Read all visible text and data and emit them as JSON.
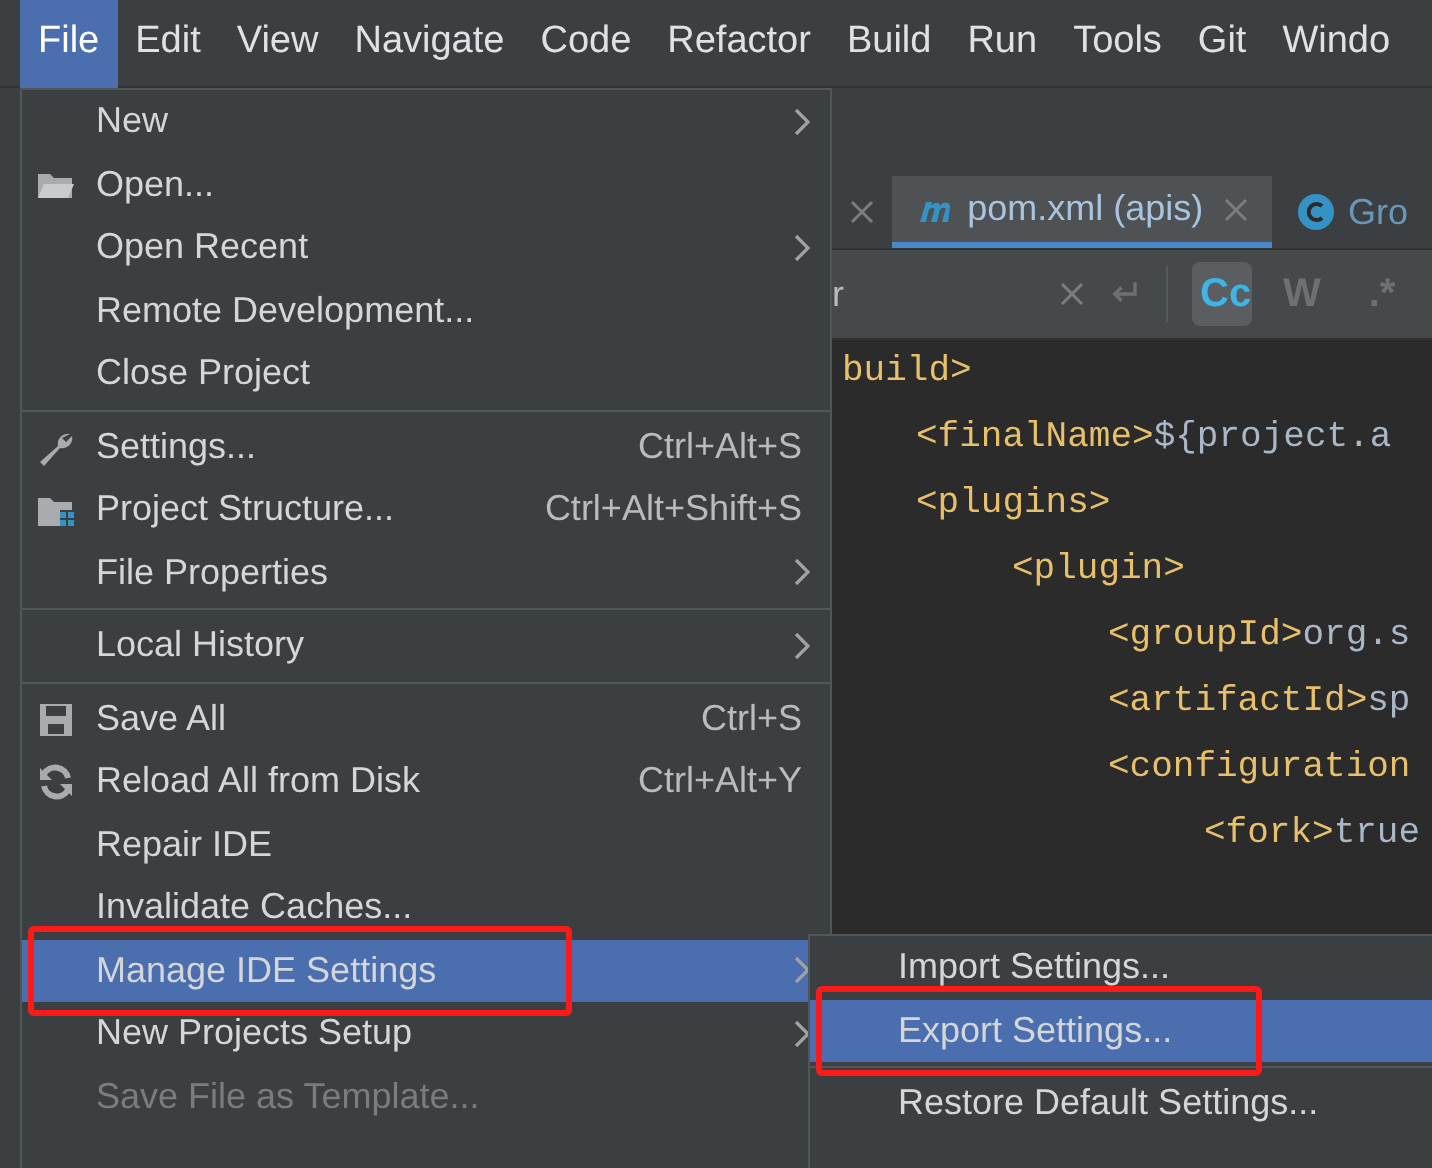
{
  "menu_bar": [
    {
      "label": "File",
      "selected": true
    },
    {
      "label": "Edit",
      "selected": false
    },
    {
      "label": "View",
      "selected": false
    },
    {
      "label": "Navigate",
      "selected": false
    },
    {
      "label": "Code",
      "selected": false
    },
    {
      "label": "Refactor",
      "selected": false
    },
    {
      "label": "Build",
      "selected": false
    },
    {
      "label": "Run",
      "selected": false
    },
    {
      "label": "Tools",
      "selected": false
    },
    {
      "label": "Git",
      "selected": false
    },
    {
      "label": "Windo",
      "selected": false
    }
  ],
  "editor": {
    "tabs": [
      {
        "label": "pom.xml (apis)",
        "selected": true,
        "closable": true
      },
      {
        "label": "Gro",
        "selected": false,
        "closable": false
      }
    ],
    "search": {
      "value": "r",
      "options": [
        {
          "label": "Cc",
          "selected": true
        },
        {
          "label": "W",
          "selected": false
        },
        {
          "label": ".*",
          "selected": false
        }
      ]
    },
    "code": [
      {
        "tag": "build>",
        "children": [
          {
            "tag": "<finalName>",
            "value": "${project.a"
          },
          {
            "tag": "<plugins>",
            "children": [
              {
                "tag": "<plugin>",
                "children": [
                  {
                    "tag": "<groupId>",
                    "value": "org.s"
                  },
                  {
                    "tag": "<artifactId>",
                    "value": "sp"
                  },
                  {
                    "tag": "<configuration",
                    "children": [
                      {
                        "tag": "<fork>",
                        "value": "true"
                      }
                    ]
                  }
                ]
              }
            ]
          }
        ]
      }
    ]
  },
  "file_menu": {
    "items": [
      {
        "kind": "item",
        "label": "New",
        "submenu": true,
        "selected": false,
        "disabled": false,
        "outlined": false
      },
      {
        "kind": "item",
        "label": "Open...",
        "submenu": false,
        "selected": false,
        "disabled": false,
        "outlined": false
      },
      {
        "kind": "item",
        "label": "Open Recent",
        "submenu": true,
        "selected": false,
        "disabled": false,
        "outlined": false
      },
      {
        "kind": "item",
        "label": "Remote Development...",
        "submenu": false,
        "selected": false,
        "disabled": false,
        "outlined": false
      },
      {
        "kind": "item",
        "label": "Close Project",
        "submenu": false,
        "selected": false,
        "disabled": false,
        "outlined": false
      },
      {
        "kind": "separator"
      },
      {
        "kind": "item",
        "label": "Settings...",
        "shortcut": "Ctrl+Alt+S",
        "submenu": false,
        "selected": false,
        "disabled": false,
        "outlined": false
      },
      {
        "kind": "item",
        "label": "Project Structure...",
        "shortcut": "Ctrl+Alt+Shift+S",
        "submenu": false,
        "selected": false,
        "disabled": false,
        "outlined": false
      },
      {
        "kind": "item",
        "label": "File Properties",
        "submenu": true,
        "selected": false,
        "disabled": false,
        "outlined": false
      },
      {
        "kind": "separator"
      },
      {
        "kind": "item",
        "label": "Local History",
        "submenu": true,
        "selected": false,
        "disabled": false,
        "outlined": false
      },
      {
        "kind": "separator"
      },
      {
        "kind": "item",
        "label": "Save All",
        "shortcut": "Ctrl+S",
        "submenu": false,
        "selected": false,
        "disabled": false,
        "outlined": false
      },
      {
        "kind": "item",
        "label": "Reload All from Disk",
        "shortcut": "Ctrl+Alt+Y",
        "submenu": false,
        "selected": false,
        "disabled": false,
        "outlined": false
      },
      {
        "kind": "item",
        "label": "Repair IDE",
        "submenu": false,
        "selected": false,
        "disabled": false,
        "outlined": false
      },
      {
        "kind": "item",
        "label": "Invalidate Caches...",
        "submenu": false,
        "selected": false,
        "disabled": false,
        "outlined": false
      },
      {
        "kind": "item",
        "label": "Manage IDE Settings",
        "submenu": true,
        "selected": true,
        "disabled": false,
        "outlined": true
      },
      {
        "kind": "item",
        "label": "New Projects Setup",
        "submenu": true,
        "selected": false,
        "disabled": false,
        "outlined": false
      },
      {
        "kind": "item",
        "label": "Save File as Template...",
        "submenu": false,
        "selected": false,
        "disabled": true,
        "outlined": false
      }
    ]
  },
  "settings_submenu": {
    "items": [
      {
        "kind": "item",
        "label": "Import Settings...",
        "submenu": false,
        "selected": false,
        "disabled": false,
        "outlined": false
      },
      {
        "kind": "item",
        "label": "Export Settings...",
        "submenu": false,
        "selected": true,
        "disabled": false,
        "outlined": true
      },
      {
        "kind": "separator"
      },
      {
        "kind": "item",
        "label": "Restore Default Settings...",
        "submenu": false,
        "selected": false,
        "disabled": false,
        "outlined": false
      }
    ]
  }
}
